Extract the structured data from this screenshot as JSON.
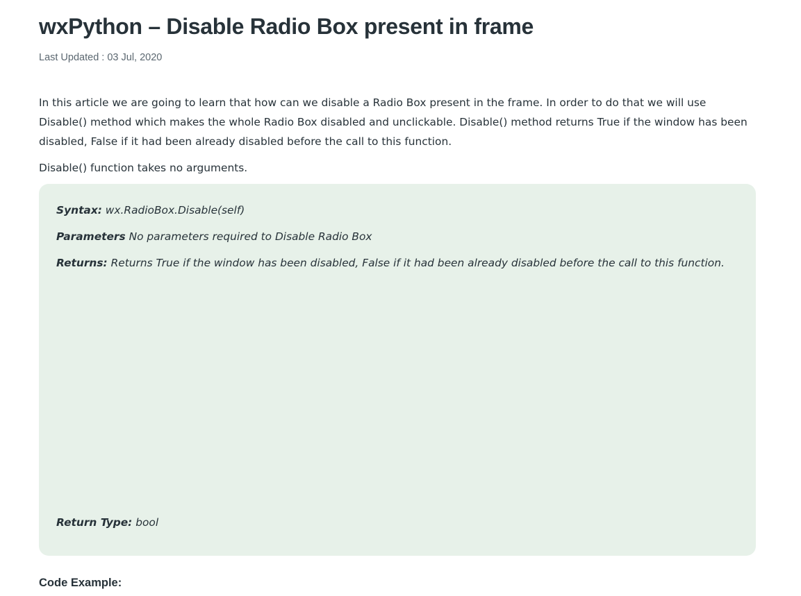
{
  "article": {
    "title": "wxPython – Disable Radio Box present in frame",
    "last_updated": "Last Updated : 03 Jul, 2020",
    "intro": "In this article we are going to learn that how can we disable a Radio Box present in the frame. In order to do that we will use Disable() method which makes the whole Radio Box disabled and unclickable. Disable() method returns True if the window has been disabled, False if it had been already disabled before the call to this function.",
    "args_note": "Disable() function takes no arguments."
  },
  "panel": {
    "syntax_label": "Syntax:",
    "syntax_value": " wx.RadioBox.Disable(self)",
    "params_label": "Parameters",
    "params_value": " No parameters required to Disable Radio Box",
    "returns_label": "Returns:",
    "returns_value": " Returns True if the window has been disabled, False if it had been already disabled before the call to this function.",
    "return_type_label": "Return Type:",
    "return_type_value": " bool"
  },
  "code_heading": "Code Example:",
  "colors": {
    "text": "#273239",
    "muted": "#5b6770",
    "panel_background": "#e7f1e9",
    "page_background": "#ffffff"
  }
}
